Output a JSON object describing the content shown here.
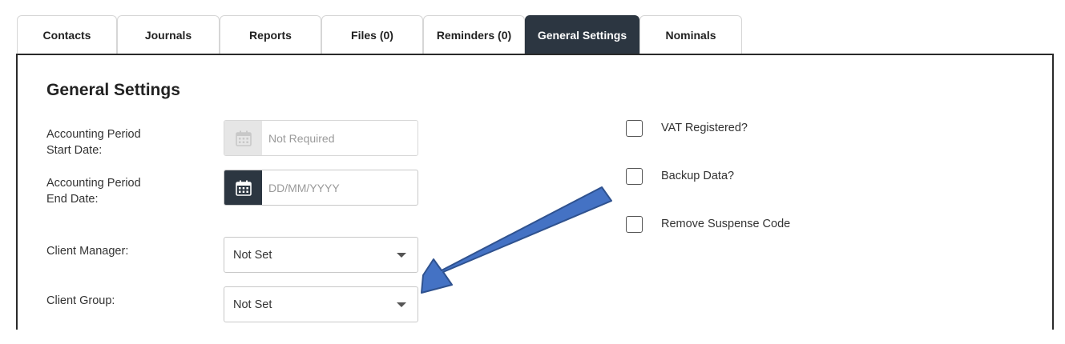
{
  "tabs": [
    {
      "label": "Contacts",
      "active": false
    },
    {
      "label": "Journals",
      "active": false
    },
    {
      "label": "Reports",
      "active": false
    },
    {
      "label": "Files (0)",
      "active": false
    },
    {
      "label": "Reminders (0)",
      "active": false
    },
    {
      "label": "General Settings",
      "active": true
    },
    {
      "label": "Nominals",
      "active": false
    }
  ],
  "section": {
    "title": "General Settings"
  },
  "fields": {
    "start_date": {
      "label_line1": "Accounting Period",
      "label_line2": "Start Date:",
      "placeholder": "Not Required",
      "disabled": true
    },
    "end_date": {
      "label_line1": "Accounting Period",
      "label_line2": "End Date:",
      "placeholder": "DD/MM/YYYY",
      "disabled": false
    },
    "client_manager": {
      "label": "Client Manager:",
      "value": "Not Set"
    },
    "client_group": {
      "label": "Client Group:",
      "value": "Not Set"
    }
  },
  "checkboxes": [
    {
      "label": "VAT Registered?",
      "checked": false
    },
    {
      "label": "Backup Data?",
      "checked": false
    },
    {
      "label": "Remove Suspense Code",
      "checked": false
    }
  ],
  "colors": {
    "accent": "#2c3641",
    "annotation_arrow": "#4472c4"
  },
  "icons": {
    "date_picker": "calendar-icon",
    "dropdown": "caret-down-icon",
    "annotation": "arrow-icon"
  }
}
